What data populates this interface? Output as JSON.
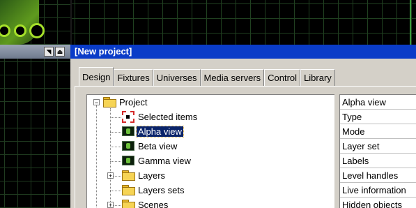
{
  "window": {
    "title": "[New project]"
  },
  "left_panel": {
    "pin_glyph": "◥",
    "eject_glyph": "⏏"
  },
  "tabs": [
    {
      "label": "Design",
      "active": true
    },
    {
      "label": "Fixtures",
      "active": false
    },
    {
      "label": "Universes",
      "active": false
    },
    {
      "label": "Media servers",
      "active": false
    },
    {
      "label": "Control",
      "active": false
    },
    {
      "label": "Library",
      "active": false
    }
  ],
  "tree": {
    "root": {
      "label": "Project",
      "expander": "−"
    },
    "items": [
      {
        "label": "Selected items",
        "icon": "selection-icon"
      },
      {
        "label": "Alpha view",
        "icon": "view-icon",
        "selected": true
      },
      {
        "label": "Beta view",
        "icon": "view-icon"
      },
      {
        "label": "Gamma view",
        "icon": "view-icon"
      },
      {
        "label": "Layers",
        "icon": "folder-icon",
        "expander": "+"
      },
      {
        "label": "Layers sets",
        "icon": "folder-icon"
      },
      {
        "label": "Scenes",
        "icon": "folder-icon",
        "expander": "+"
      }
    ]
  },
  "properties": {
    "rows": [
      "Alpha view",
      "Type",
      "Mode",
      "Layer set",
      "Labels",
      "Level handles",
      "Live information",
      "Hidden objects"
    ]
  },
  "colors": {
    "title_bar": "#0a3cc8",
    "selection": "#0a246a",
    "logo_green": "#a6e02a"
  }
}
